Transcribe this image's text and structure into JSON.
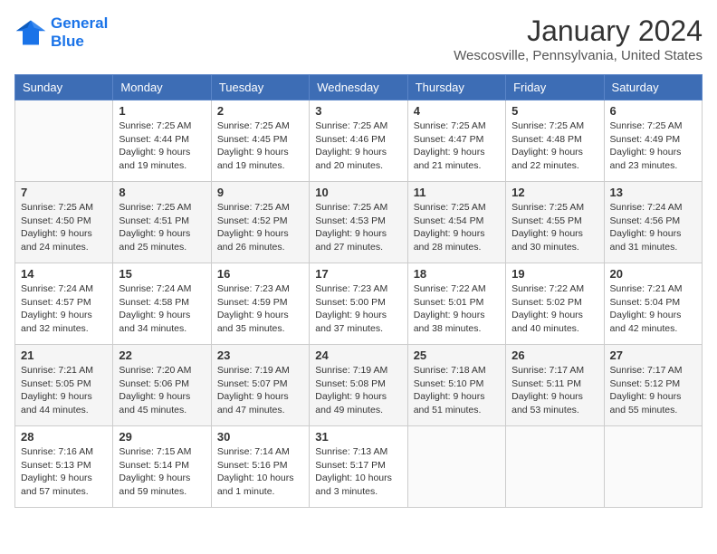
{
  "header": {
    "logo_line1": "General",
    "logo_line2": "Blue",
    "month": "January 2024",
    "location": "Wescosville, Pennsylvania, United States"
  },
  "weekdays": [
    "Sunday",
    "Monday",
    "Tuesday",
    "Wednesday",
    "Thursday",
    "Friday",
    "Saturday"
  ],
  "weeks": [
    [
      {
        "day": "",
        "sunrise": "",
        "sunset": "",
        "daylight": ""
      },
      {
        "day": "1",
        "sunrise": "Sunrise: 7:25 AM",
        "sunset": "Sunset: 4:44 PM",
        "daylight": "Daylight: 9 hours and 19 minutes."
      },
      {
        "day": "2",
        "sunrise": "Sunrise: 7:25 AM",
        "sunset": "Sunset: 4:45 PM",
        "daylight": "Daylight: 9 hours and 19 minutes."
      },
      {
        "day": "3",
        "sunrise": "Sunrise: 7:25 AM",
        "sunset": "Sunset: 4:46 PM",
        "daylight": "Daylight: 9 hours and 20 minutes."
      },
      {
        "day": "4",
        "sunrise": "Sunrise: 7:25 AM",
        "sunset": "Sunset: 4:47 PM",
        "daylight": "Daylight: 9 hours and 21 minutes."
      },
      {
        "day": "5",
        "sunrise": "Sunrise: 7:25 AM",
        "sunset": "Sunset: 4:48 PM",
        "daylight": "Daylight: 9 hours and 22 minutes."
      },
      {
        "day": "6",
        "sunrise": "Sunrise: 7:25 AM",
        "sunset": "Sunset: 4:49 PM",
        "daylight": "Daylight: 9 hours and 23 minutes."
      }
    ],
    [
      {
        "day": "7",
        "sunrise": "Sunrise: 7:25 AM",
        "sunset": "Sunset: 4:50 PM",
        "daylight": "Daylight: 9 hours and 24 minutes."
      },
      {
        "day": "8",
        "sunrise": "Sunrise: 7:25 AM",
        "sunset": "Sunset: 4:51 PM",
        "daylight": "Daylight: 9 hours and 25 minutes."
      },
      {
        "day": "9",
        "sunrise": "Sunrise: 7:25 AM",
        "sunset": "Sunset: 4:52 PM",
        "daylight": "Daylight: 9 hours and 26 minutes."
      },
      {
        "day": "10",
        "sunrise": "Sunrise: 7:25 AM",
        "sunset": "Sunset: 4:53 PM",
        "daylight": "Daylight: 9 hours and 27 minutes."
      },
      {
        "day": "11",
        "sunrise": "Sunrise: 7:25 AM",
        "sunset": "Sunset: 4:54 PM",
        "daylight": "Daylight: 9 hours and 28 minutes."
      },
      {
        "day": "12",
        "sunrise": "Sunrise: 7:25 AM",
        "sunset": "Sunset: 4:55 PM",
        "daylight": "Daylight: 9 hours and 30 minutes."
      },
      {
        "day": "13",
        "sunrise": "Sunrise: 7:24 AM",
        "sunset": "Sunset: 4:56 PM",
        "daylight": "Daylight: 9 hours and 31 minutes."
      }
    ],
    [
      {
        "day": "14",
        "sunrise": "Sunrise: 7:24 AM",
        "sunset": "Sunset: 4:57 PM",
        "daylight": "Daylight: 9 hours and 32 minutes."
      },
      {
        "day": "15",
        "sunrise": "Sunrise: 7:24 AM",
        "sunset": "Sunset: 4:58 PM",
        "daylight": "Daylight: 9 hours and 34 minutes."
      },
      {
        "day": "16",
        "sunrise": "Sunrise: 7:23 AM",
        "sunset": "Sunset: 4:59 PM",
        "daylight": "Daylight: 9 hours and 35 minutes."
      },
      {
        "day": "17",
        "sunrise": "Sunrise: 7:23 AM",
        "sunset": "Sunset: 5:00 PM",
        "daylight": "Daylight: 9 hours and 37 minutes."
      },
      {
        "day": "18",
        "sunrise": "Sunrise: 7:22 AM",
        "sunset": "Sunset: 5:01 PM",
        "daylight": "Daylight: 9 hours and 38 minutes."
      },
      {
        "day": "19",
        "sunrise": "Sunrise: 7:22 AM",
        "sunset": "Sunset: 5:02 PM",
        "daylight": "Daylight: 9 hours and 40 minutes."
      },
      {
        "day": "20",
        "sunrise": "Sunrise: 7:21 AM",
        "sunset": "Sunset: 5:04 PM",
        "daylight": "Daylight: 9 hours and 42 minutes."
      }
    ],
    [
      {
        "day": "21",
        "sunrise": "Sunrise: 7:21 AM",
        "sunset": "Sunset: 5:05 PM",
        "daylight": "Daylight: 9 hours and 44 minutes."
      },
      {
        "day": "22",
        "sunrise": "Sunrise: 7:20 AM",
        "sunset": "Sunset: 5:06 PM",
        "daylight": "Daylight: 9 hours and 45 minutes."
      },
      {
        "day": "23",
        "sunrise": "Sunrise: 7:19 AM",
        "sunset": "Sunset: 5:07 PM",
        "daylight": "Daylight: 9 hours and 47 minutes."
      },
      {
        "day": "24",
        "sunrise": "Sunrise: 7:19 AM",
        "sunset": "Sunset: 5:08 PM",
        "daylight": "Daylight: 9 hours and 49 minutes."
      },
      {
        "day": "25",
        "sunrise": "Sunrise: 7:18 AM",
        "sunset": "Sunset: 5:10 PM",
        "daylight": "Daylight: 9 hours and 51 minutes."
      },
      {
        "day": "26",
        "sunrise": "Sunrise: 7:17 AM",
        "sunset": "Sunset: 5:11 PM",
        "daylight": "Daylight: 9 hours and 53 minutes."
      },
      {
        "day": "27",
        "sunrise": "Sunrise: 7:17 AM",
        "sunset": "Sunset: 5:12 PM",
        "daylight": "Daylight: 9 hours and 55 minutes."
      }
    ],
    [
      {
        "day": "28",
        "sunrise": "Sunrise: 7:16 AM",
        "sunset": "Sunset: 5:13 PM",
        "daylight": "Daylight: 9 hours and 57 minutes."
      },
      {
        "day": "29",
        "sunrise": "Sunrise: 7:15 AM",
        "sunset": "Sunset: 5:14 PM",
        "daylight": "Daylight: 9 hours and 59 minutes."
      },
      {
        "day": "30",
        "sunrise": "Sunrise: 7:14 AM",
        "sunset": "Sunset: 5:16 PM",
        "daylight": "Daylight: 10 hours and 1 minute."
      },
      {
        "day": "31",
        "sunrise": "Sunrise: 7:13 AM",
        "sunset": "Sunset: 5:17 PM",
        "daylight": "Daylight: 10 hours and 3 minutes."
      },
      {
        "day": "",
        "sunrise": "",
        "sunset": "",
        "daylight": ""
      },
      {
        "day": "",
        "sunrise": "",
        "sunset": "",
        "daylight": ""
      },
      {
        "day": "",
        "sunrise": "",
        "sunset": "",
        "daylight": ""
      }
    ]
  ]
}
